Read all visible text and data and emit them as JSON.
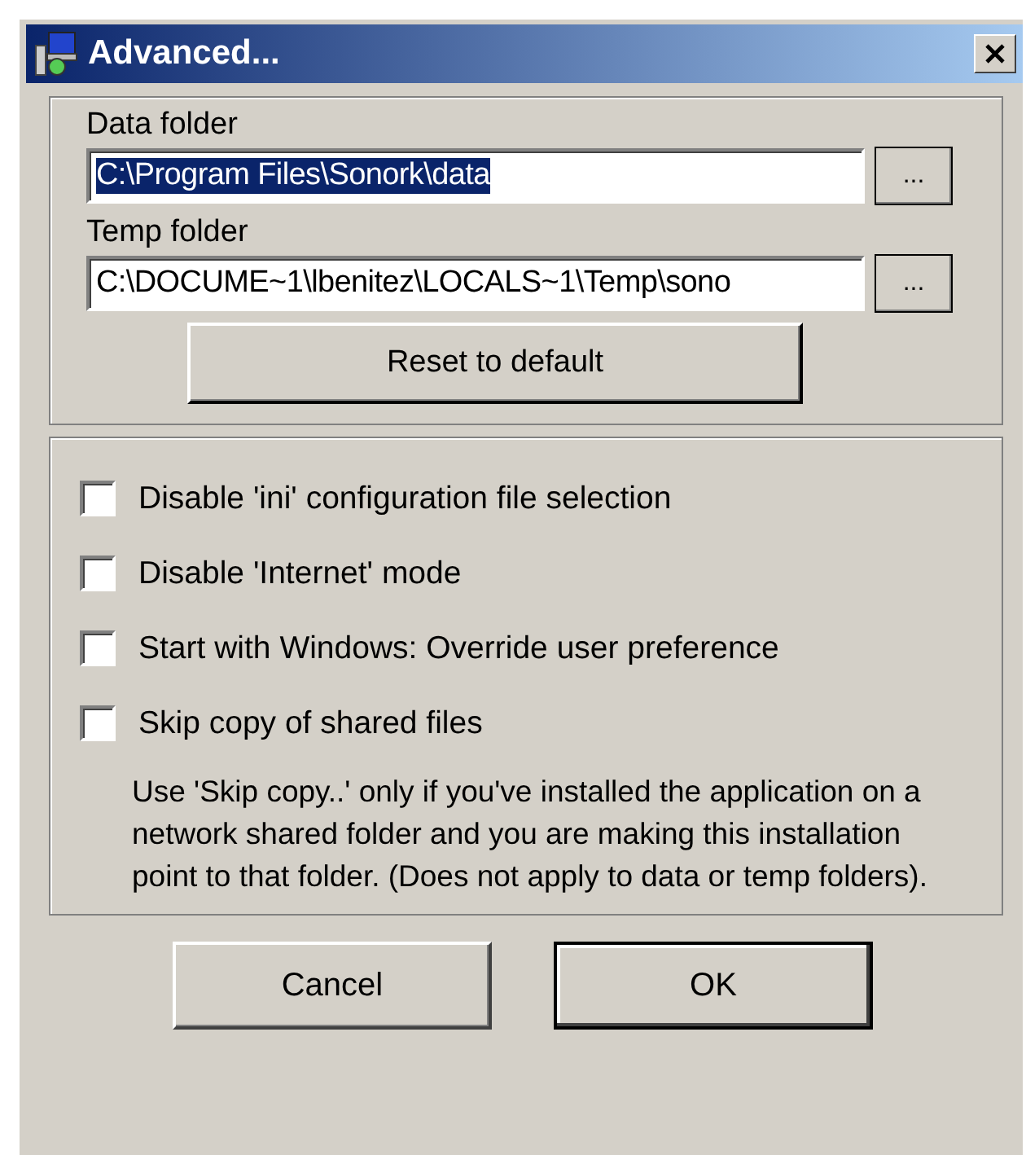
{
  "window": {
    "title": "Advanced..."
  },
  "folders": [
    {
      "label": "Data folder",
      "value": "C:\\Program Files\\Sonork\\data",
      "text_selected": true,
      "browse": "..."
    },
    {
      "label": "Temp folder",
      "value": "C:\\DOCUME~1\\lbenitez\\LOCALS~1\\Temp\\sono",
      "text_selected": false,
      "browse": "..."
    }
  ],
  "reset_button": "Reset to default",
  "options": [
    {
      "label": "Disable 'ini' configuration file selection",
      "checked": false
    },
    {
      "label": "Disable 'Internet' mode",
      "checked": false
    },
    {
      "label": "Start with Windows: Override user preference",
      "checked": false
    },
    {
      "label": "Skip copy of shared files",
      "checked": false
    }
  ],
  "note": "Use 'Skip copy..' only if you've installed the application on a network shared folder and you are making this installation point to that folder. (Does not apply to data or temp folders).",
  "buttons": [
    {
      "label": "Cancel",
      "default": false
    },
    {
      "label": "OK",
      "default": true
    }
  ]
}
